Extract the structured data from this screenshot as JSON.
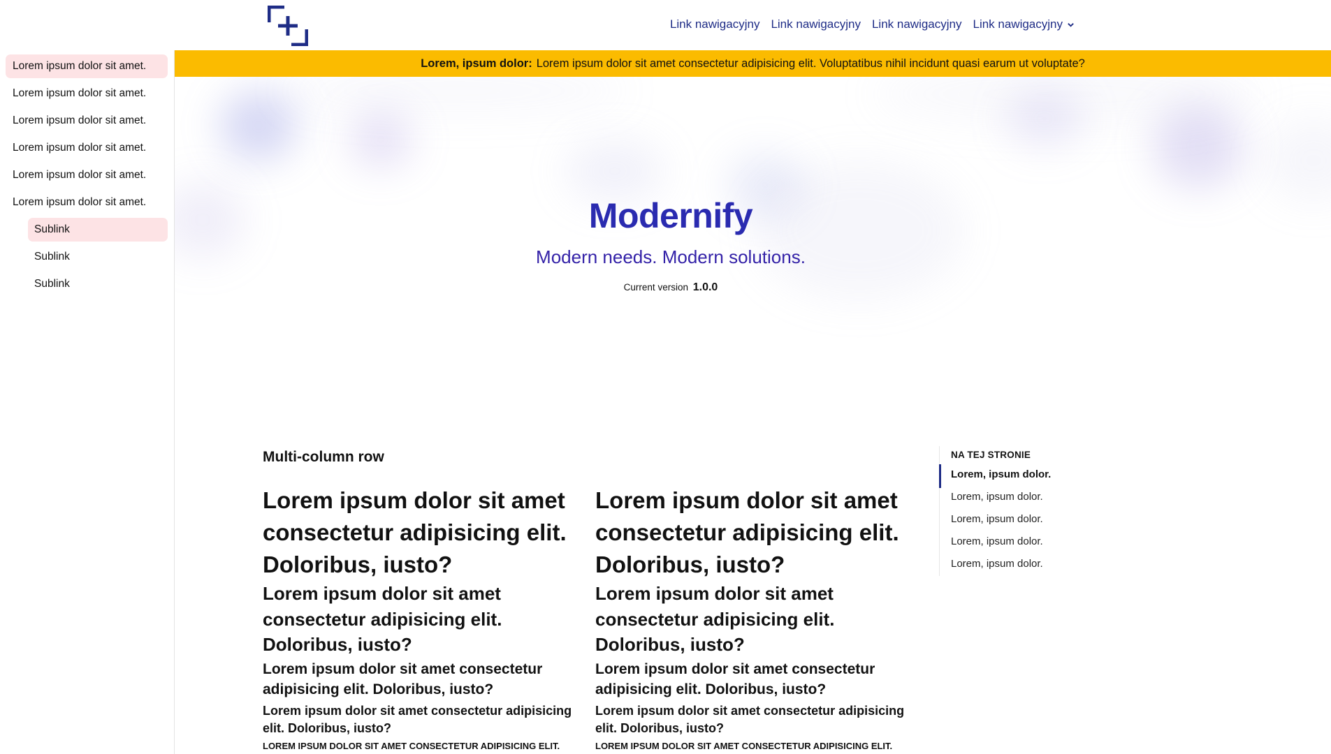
{
  "header": {
    "logo_icon": "modernify-bracket-plus-logo",
    "nav": [
      {
        "label": "Link nawigacyjny"
      },
      {
        "label": "Link nawigacyjny"
      },
      {
        "label": "Link nawigacyjny"
      },
      {
        "label": "Link nawigacyjny",
        "icon": "chevron-down-icon"
      }
    ],
    "nav_color": "#1e2c86"
  },
  "sidebar": {
    "items": [
      {
        "label": "Lorem ipsum dolor sit amet.",
        "active": true
      },
      {
        "label": "Lorem ipsum dolor sit amet."
      },
      {
        "label": "Lorem ipsum dolor sit amet."
      },
      {
        "label": "Lorem ipsum dolor sit amet."
      },
      {
        "label": "Lorem ipsum dolor sit amet."
      },
      {
        "label": "Lorem ipsum dolor sit amet."
      }
    ],
    "subitems": [
      {
        "label": "Sublink",
        "active": true
      },
      {
        "label": "Sublink"
      },
      {
        "label": "Sublink"
      }
    ],
    "active_color": "#fde3e5"
  },
  "banner": {
    "lead": "Lorem, ipsum dolor:",
    "text": "Lorem ipsum dolor sit amet consectetur adipisicing elit. Voluptatibus nihil incidunt quasi earum ut voluptate?",
    "color": "#fbbb00"
  },
  "hero": {
    "title": "Modernify",
    "subtitle": "Modern needs. Modern solutions.",
    "version_label": "Current version",
    "version": "1.0.0",
    "title_color": "#2a2bb0"
  },
  "main": {
    "section_title": "Multi-column row",
    "columns": [
      {
        "h1": "Lorem ipsum dolor sit amet consectetur adipisicing elit. Doloribus, iusto?",
        "h2": "Lorem ipsum dolor sit amet consectetur adipisicing elit. Doloribus, iusto?",
        "h3": "Lorem ipsum dolor sit amet consectetur adipisicing elit. Doloribus, iusto?",
        "h4": "Lorem ipsum dolor sit amet consectetur adipisicing elit. Doloribus, iusto?",
        "h5": "Lorem ipsum dolor sit amet consectetur adipisicing elit."
      },
      {
        "h1": "Lorem ipsum dolor sit amet consectetur adipisicing elit. Doloribus, iusto?",
        "h2": "Lorem ipsum dolor sit amet consectetur adipisicing elit. Doloribus, iusto?",
        "h3": "Lorem ipsum dolor sit amet consectetur adipisicing elit. Doloribus, iusto?",
        "h4": "Lorem ipsum dolor sit amet consectetur adipisicing elit. Doloribus, iusto?",
        "h5": "Lorem ipsum dolor sit amet consectetur adipisicing elit."
      }
    ]
  },
  "toc": {
    "title": "NA TEJ STRONIE",
    "items": [
      {
        "label": "Lorem, ipsum dolor.",
        "active": true
      },
      {
        "label": "Lorem, ipsum dolor."
      },
      {
        "label": "Lorem, ipsum dolor."
      },
      {
        "label": "Lorem, ipsum dolor."
      },
      {
        "label": "Lorem, ipsum dolor."
      }
    ],
    "marker_color": "#1e2c86"
  }
}
